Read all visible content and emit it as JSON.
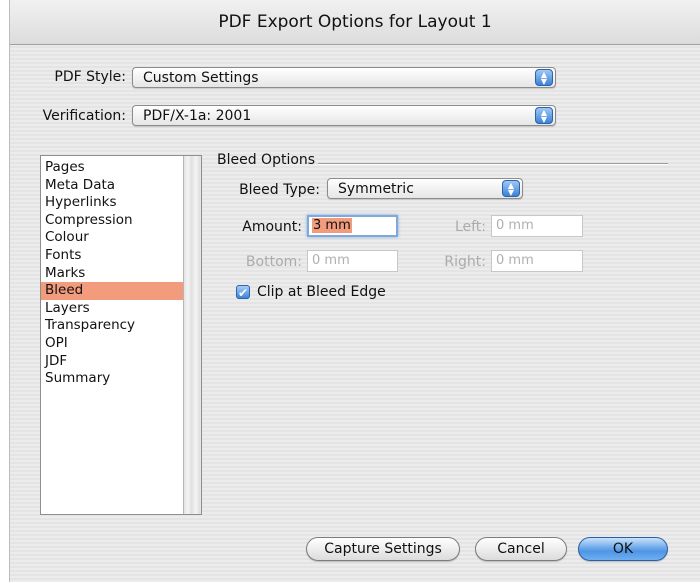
{
  "window": {
    "title": "PDF Export Options for Layout 1"
  },
  "pdf_style": {
    "label": "PDF Style:",
    "value": "Custom Settings"
  },
  "verification": {
    "label": "Verification:",
    "value": "PDF/X-1a: 2001"
  },
  "sidebar": {
    "items": [
      {
        "label": "Pages"
      },
      {
        "label": "Meta Data"
      },
      {
        "label": "Hyperlinks"
      },
      {
        "label": "Compression"
      },
      {
        "label": "Colour"
      },
      {
        "label": "Fonts"
      },
      {
        "label": "Marks"
      },
      {
        "label": "Bleed"
      },
      {
        "label": "Layers"
      },
      {
        "label": "Transparency"
      },
      {
        "label": "OPI"
      },
      {
        "label": "JDF"
      },
      {
        "label": "Summary"
      }
    ],
    "selected_index": 7
  },
  "bleed": {
    "group_title": "Bleed Options",
    "type_label": "Bleed Type:",
    "type_value": "Symmetric",
    "amount_label": "Amount:",
    "amount_value": "3 mm",
    "left_label": "Left:",
    "left_value": "0 mm",
    "bottom_label": "Bottom:",
    "bottom_value": "0 mm",
    "right_label": "Right:",
    "right_value": "0 mm",
    "clip_label": "Clip at Bleed Edge",
    "clip_checked": true
  },
  "buttons": {
    "capture": "Capture Settings",
    "cancel": "Cancel",
    "ok": "OK"
  },
  "colors": {
    "selection": "#f29b7d",
    "accent_blue": "#3b82d8"
  }
}
